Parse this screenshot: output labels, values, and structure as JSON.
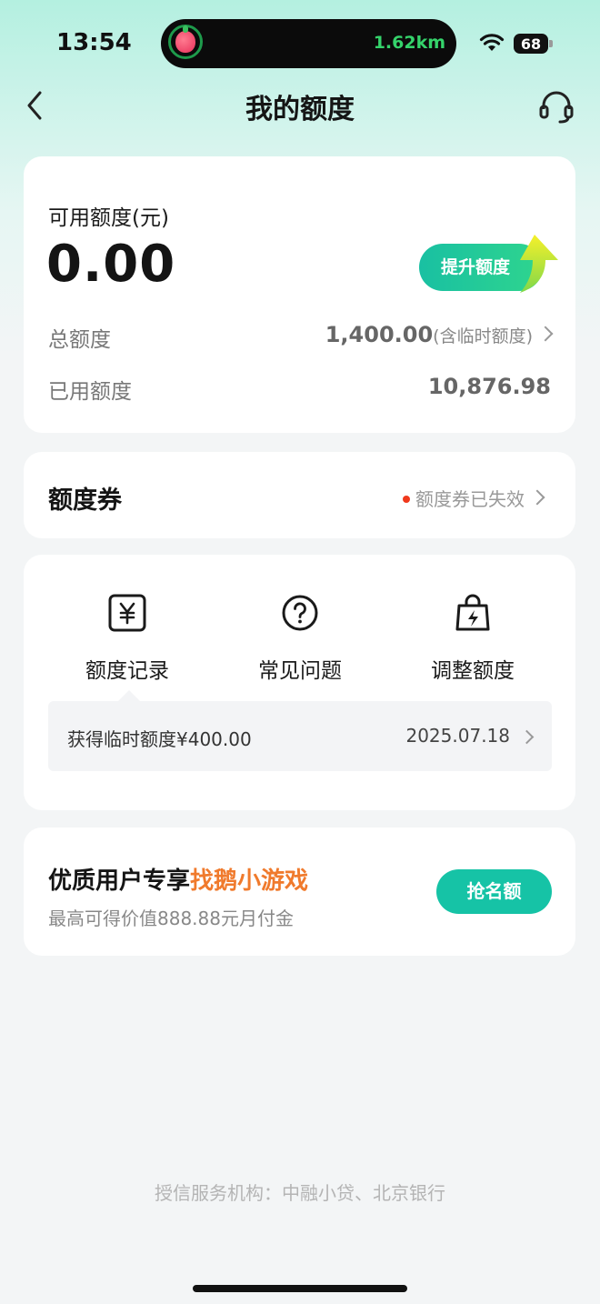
{
  "status_bar": {
    "time": "13:54",
    "island_distance": "1.62km",
    "battery": "68"
  },
  "nav": {
    "title": "我的额度"
  },
  "quota_card": {
    "available_label": "可用额度(元)",
    "available_amount": "0.00",
    "raise_button": "提升额度",
    "total_label": "总额度",
    "total_value": "1,400.00",
    "total_note": "(含临时额度)",
    "used_label": "已用额度",
    "used_value": "10,876.98"
  },
  "coupon": {
    "title": "额度券",
    "status": "额度券已失效"
  },
  "features": [
    {
      "label": "额度记录",
      "icon": "yuan-receipt-icon"
    },
    {
      "label": "常见问题",
      "icon": "question-circle-icon"
    },
    {
      "label": "调整额度",
      "icon": "bag-lightning-icon"
    }
  ],
  "record": {
    "text": "获得临时额度¥400.00",
    "date": "2025.07.18"
  },
  "promo": {
    "title_prefix": "优质用户专享",
    "title_highlight": "找鹅小游戏",
    "subtitle": "最高可得价值888.88元月付金",
    "button": "抢名额"
  },
  "footer": {
    "note": "授信服务机构：中融小贷、北京银行"
  },
  "colors": {
    "accent": "#16c3a6",
    "highlight": "#f07a2c",
    "alert_dot": "#f0391c"
  }
}
